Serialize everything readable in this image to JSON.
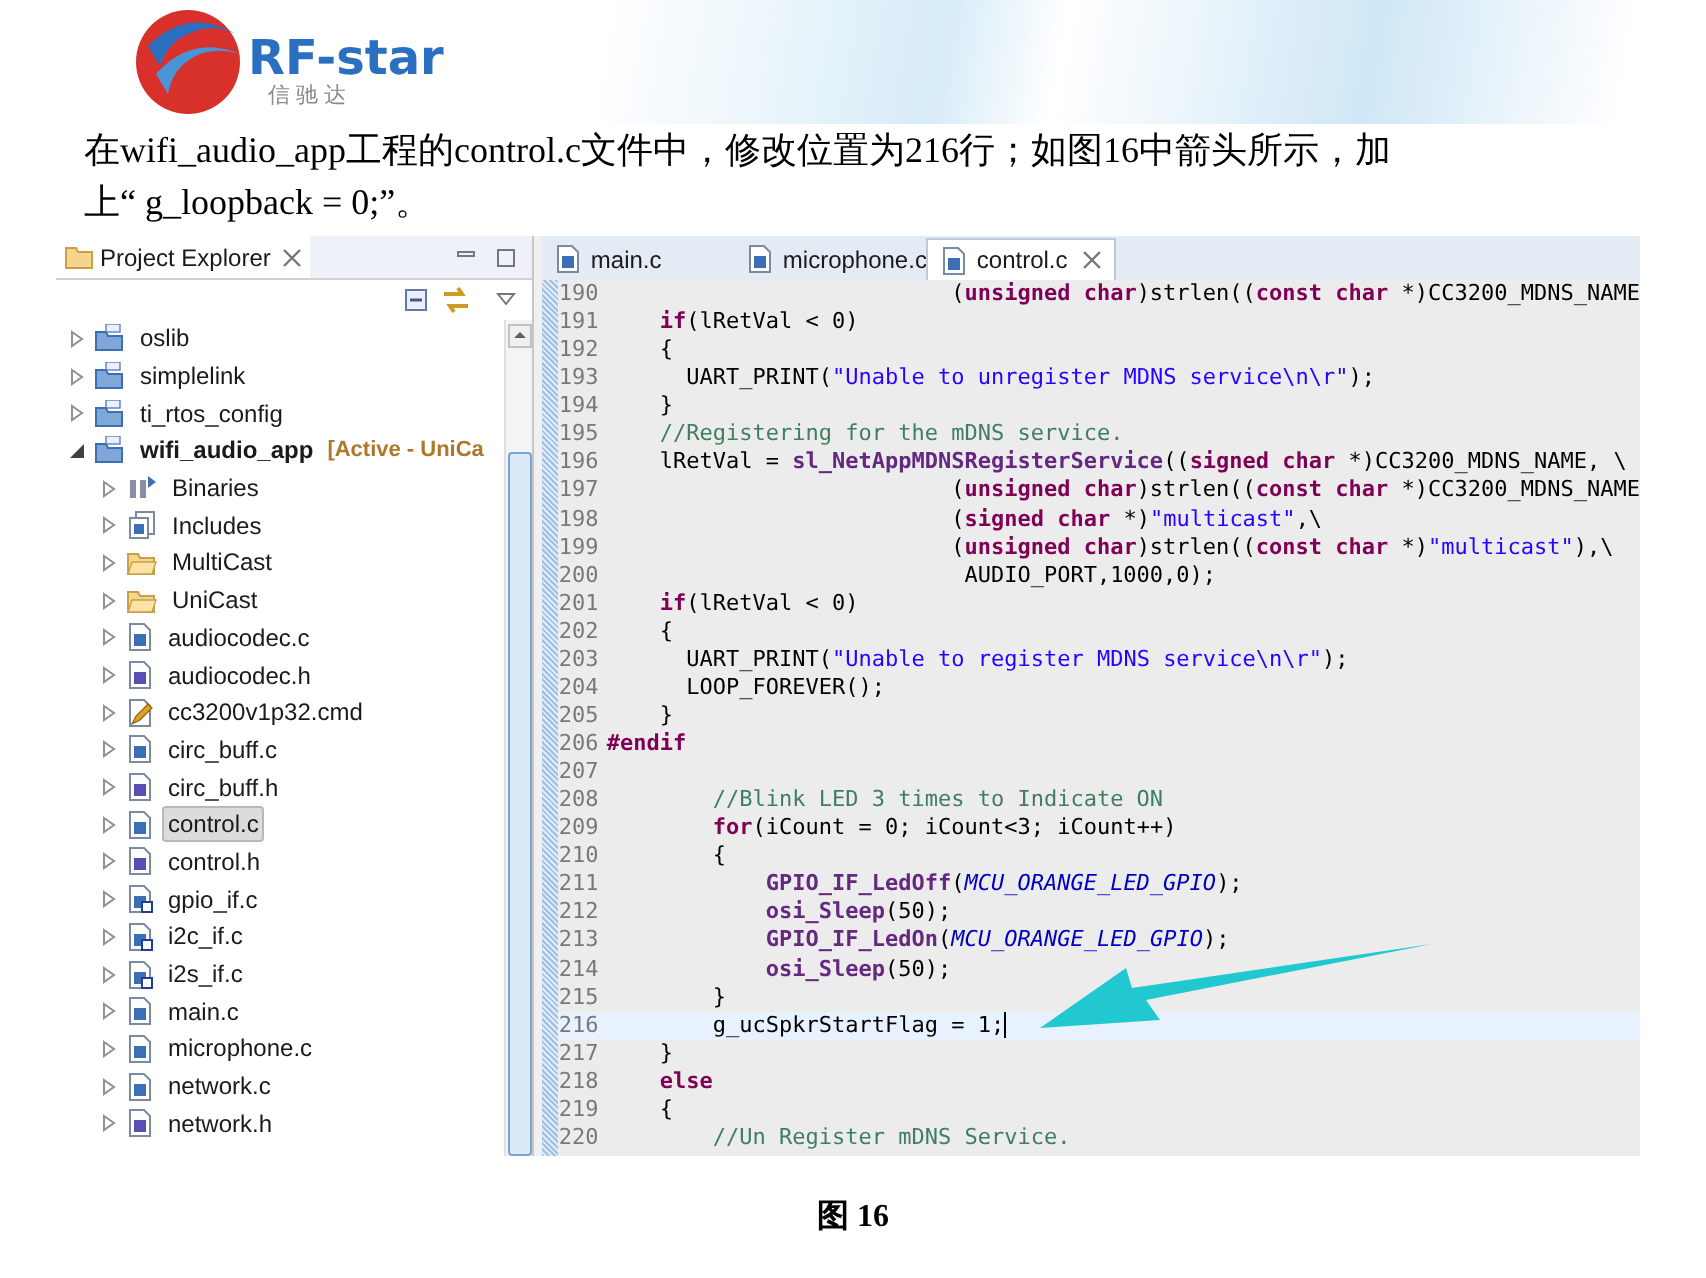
{
  "header": {
    "logo_text": "RF-star",
    "logo_subtitle": "信 驰 达"
  },
  "instruction": "在wifi_audio_app工程的control.c文件中，修改位置为216行；如图16中箭头所示，加上“ g_loopback = 0;”。",
  "explorer": {
    "title": "Project Explorer",
    "items": [
      {
        "label": "oslib",
        "kind": "project",
        "expanded": false,
        "selected": false
      },
      {
        "label": "simplelink",
        "kind": "project",
        "expanded": false,
        "selected": false
      },
      {
        "label": "ti_rtos_config",
        "kind": "project",
        "expanded": false,
        "selected": false
      },
      {
        "label": "wifi_audio_app",
        "decoration": "[Active - UniCa",
        "kind": "project",
        "expanded": true,
        "selected": false,
        "children": [
          {
            "label": "Binaries",
            "kind": "binaries",
            "expanded": false,
            "selected": false
          },
          {
            "label": "Includes",
            "kind": "includes",
            "expanded": false,
            "selected": false
          },
          {
            "label": "MultiCast",
            "kind": "folder",
            "expanded": false,
            "selected": false
          },
          {
            "label": "UniCast",
            "kind": "folder",
            "expanded": false,
            "selected": false
          },
          {
            "label": "audiocodec.c",
            "kind": "c",
            "expanded": false,
            "selected": false
          },
          {
            "label": "audiocodec.h",
            "kind": "h",
            "expanded": false,
            "selected": false
          },
          {
            "label": "cc3200v1p32.cmd",
            "kind": "cmd",
            "expanded": false,
            "selected": false
          },
          {
            "label": "circ_buff.c",
            "kind": "c",
            "expanded": false,
            "selected": false
          },
          {
            "label": "circ_buff.h",
            "kind": "h",
            "expanded": false,
            "selected": false
          },
          {
            "label": "control.c",
            "kind": "c",
            "expanded": false,
            "selected": true
          },
          {
            "label": "control.h",
            "kind": "h",
            "expanded": false,
            "selected": false
          },
          {
            "label": "gpio_if.c",
            "kind": "link",
            "expanded": false,
            "selected": false
          },
          {
            "label": "i2c_if.c",
            "kind": "link",
            "expanded": false,
            "selected": false
          },
          {
            "label": "i2s_if.c",
            "kind": "link",
            "expanded": false,
            "selected": false
          },
          {
            "label": "main.c",
            "kind": "c",
            "expanded": false,
            "selected": false
          },
          {
            "label": "microphone.c",
            "kind": "c",
            "expanded": false,
            "selected": false
          },
          {
            "label": "network.c",
            "kind": "c",
            "expanded": false,
            "selected": false
          },
          {
            "label": "network.h",
            "kind": "h",
            "expanded": false,
            "selected": false
          }
        ]
      }
    ]
  },
  "editor": {
    "tabs": [
      {
        "label": "main.c",
        "selected": false
      },
      {
        "label": "microphone.c",
        "selected": false
      },
      {
        "label": "control.c",
        "selected": true
      }
    ],
    "lines": [
      {
        "number": "190",
        "current": false,
        "segments": [
          {
            "kind": "plain",
            "t": "                          ("
          },
          {
            "kind": "kw",
            "t": "unsigned char"
          },
          {
            "kind": "plain",
            "t": ")strlen(("
          },
          {
            "kind": "kw",
            "t": "const char"
          },
          {
            "kind": "plain",
            "t": " *)CC3200_MDNS_NAME"
          }
        ]
      },
      {
        "number": "191",
        "current": false,
        "segments": [
          {
            "kind": "kw",
            "t": "    if"
          },
          {
            "kind": "plain",
            "t": "(lRetVal < 0)"
          }
        ]
      },
      {
        "number": "192",
        "current": false,
        "segments": [
          {
            "kind": "plain",
            "t": "    {"
          }
        ]
      },
      {
        "number": "193",
        "current": false,
        "segments": [
          {
            "kind": "plain",
            "t": "      UART_PRINT("
          },
          {
            "kind": "str",
            "t": "\"Unable to unregister MDNS service\\n\\r\""
          },
          {
            "kind": "plain",
            "t": ");"
          }
        ]
      },
      {
        "number": "194",
        "current": false,
        "segments": [
          {
            "kind": "plain",
            "t": "    }"
          }
        ]
      },
      {
        "number": "195",
        "current": false,
        "segments": [
          {
            "kind": "cmt",
            "t": "    //Registering for the mDNS service."
          }
        ]
      },
      {
        "number": "196",
        "current": false,
        "segments": [
          {
            "kind": "plain",
            "t": "    lRetVal = "
          },
          {
            "kind": "fn",
            "t": "sl_NetAppMDNSRegisterService"
          },
          {
            "kind": "plain",
            "t": "(("
          },
          {
            "kind": "kw",
            "t": "signed char"
          },
          {
            "kind": "plain",
            "t": " *)CC3200_MDNS_NAME, \\"
          }
        ]
      },
      {
        "number": "197",
        "current": false,
        "segments": [
          {
            "kind": "plain",
            "t": "                          ("
          },
          {
            "kind": "kw",
            "t": "unsigned char"
          },
          {
            "kind": "plain",
            "t": ")strlen(("
          },
          {
            "kind": "kw",
            "t": "const char"
          },
          {
            "kind": "plain",
            "t": " *)CC3200_MDNS_NAME"
          }
        ]
      },
      {
        "number": "198",
        "current": false,
        "segments": [
          {
            "kind": "plain",
            "t": "                          ("
          },
          {
            "kind": "kw",
            "t": "signed char"
          },
          {
            "kind": "plain",
            "t": " *)"
          },
          {
            "kind": "str",
            "t": "\"multicast\""
          },
          {
            "kind": "plain",
            "t": ",\\"
          }
        ]
      },
      {
        "number": "199",
        "current": false,
        "segments": [
          {
            "kind": "plain",
            "t": "                          ("
          },
          {
            "kind": "kw",
            "t": "unsigned char"
          },
          {
            "kind": "plain",
            "t": ")strlen(("
          },
          {
            "kind": "kw",
            "t": "const char"
          },
          {
            "kind": "plain",
            "t": " *)"
          },
          {
            "kind": "str",
            "t": "\"multicast\""
          },
          {
            "kind": "plain",
            "t": "),\\"
          }
        ]
      },
      {
        "number": "200",
        "current": false,
        "segments": [
          {
            "kind": "plain",
            "t": "                           AUDIO_PORT,1000,0);"
          }
        ]
      },
      {
        "number": "201",
        "current": false,
        "segments": [
          {
            "kind": "kw",
            "t": "    if"
          },
          {
            "kind": "plain",
            "t": "(lRetVal < 0)"
          }
        ]
      },
      {
        "number": "202",
        "current": false,
        "segments": [
          {
            "kind": "plain",
            "t": "    {"
          }
        ]
      },
      {
        "number": "203",
        "current": false,
        "segments": [
          {
            "kind": "plain",
            "t": "      UART_PRINT("
          },
          {
            "kind": "str",
            "t": "\"Unable to register MDNS service\\n\\r\""
          },
          {
            "kind": "plain",
            "t": ");"
          }
        ]
      },
      {
        "number": "204",
        "current": false,
        "segments": [
          {
            "kind": "plain",
            "t": "      LOOP_FOREVER();"
          }
        ]
      },
      {
        "number": "205",
        "current": false,
        "segments": [
          {
            "kind": "plain",
            "t": "    }"
          }
        ]
      },
      {
        "number": "206",
        "current": false,
        "segments": [
          {
            "kind": "kw",
            "t": "#endif"
          }
        ]
      },
      {
        "number": "207",
        "current": false
      },
      {
        "number": "208",
        "current": false,
        "segments": [
          {
            "kind": "cmt",
            "t": "        //Blink LED 3 times to Indicate ON"
          }
        ]
      },
      {
        "number": "209",
        "current": false,
        "segments": [
          {
            "kind": "kw",
            "t": "        for"
          },
          {
            "kind": "plain",
            "t": "(iCount = 0; iCount<3; iCount++)"
          }
        ]
      },
      {
        "number": "210",
        "current": false,
        "segments": [
          {
            "kind": "plain",
            "t": "        {"
          }
        ]
      },
      {
        "number": "211",
        "current": false,
        "segments": [
          {
            "kind": "fn",
            "t": "            GPIO_IF_LedOff"
          },
          {
            "kind": "plain",
            "t": "("
          },
          {
            "kind": "macro",
            "t": "MCU_ORANGE_LED_GPIO"
          },
          {
            "kind": "plain",
            "t": ");"
          }
        ]
      },
      {
        "number": "212",
        "current": false,
        "segments": [
          {
            "kind": "fn",
            "t": "            osi_Sleep"
          },
          {
            "kind": "plain",
            "t": "(50);"
          }
        ]
      },
      {
        "number": "213",
        "current": false,
        "segments": [
          {
            "kind": "fn",
            "t": "            GPIO_IF_LedOn"
          },
          {
            "kind": "plain",
            "t": "("
          },
          {
            "kind": "macro",
            "t": "MCU_ORANGE_LED_GPIO"
          },
          {
            "kind": "plain",
            "t": ");"
          }
        ]
      },
      {
        "number": "214",
        "current": false,
        "segments": [
          {
            "kind": "fn",
            "t": "            osi_Sleep"
          },
          {
            "kind": "plain",
            "t": "(50);"
          }
        ]
      },
      {
        "number": "215",
        "current": false,
        "segments": [
          {
            "kind": "plain",
            "t": "        }"
          }
        ]
      },
      {
        "number": "216",
        "current": true,
        "segments": [
          {
            "kind": "plain",
            "t": "        g_ucSpkrStartFlag = 1;"
          }
        ]
      },
      {
        "number": "217",
        "current": false,
        "segments": [
          {
            "kind": "plain",
            "t": "    }"
          }
        ]
      },
      {
        "number": "218",
        "current": false,
        "segments": [
          {
            "kind": "kw",
            "t": "    else"
          }
        ]
      },
      {
        "number": "219",
        "current": false,
        "segments": [
          {
            "kind": "plain",
            "t": "    {"
          }
        ]
      },
      {
        "number": "220",
        "current": false,
        "segments": [
          {
            "kind": "cmt",
            "t": "        //Un Register mDNS Service."
          }
        ]
      }
    ]
  },
  "caption": "图 16"
}
